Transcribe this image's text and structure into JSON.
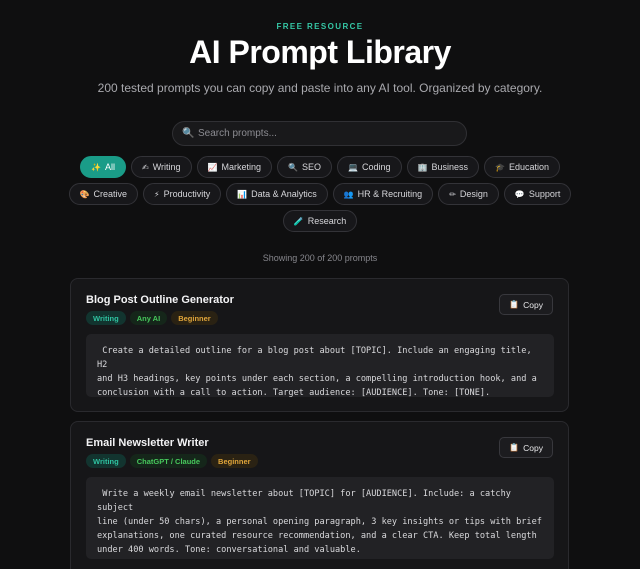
{
  "hero": {
    "eyebrow": "FREE RESOURCE",
    "title": "AI Prompt Library",
    "subtitle": "200 tested prompts you can copy and paste into any AI tool. Organized by category."
  },
  "search": {
    "icon": "search-icon",
    "placeholder": "Search prompts..."
  },
  "categories": [
    {
      "label": "All",
      "icon": "✨",
      "active": true
    },
    {
      "label": "Writing",
      "icon": "✍"
    },
    {
      "label": "Marketing",
      "icon": "📈"
    },
    {
      "label": "SEO",
      "icon": "🔍"
    },
    {
      "label": "Coding",
      "icon": "💻"
    },
    {
      "label": "Business",
      "icon": "🏢"
    },
    {
      "label": "Education",
      "icon": "🎓"
    },
    {
      "label": "Creative",
      "icon": "🎨"
    },
    {
      "label": "Productivity",
      "icon": "⚡"
    },
    {
      "label": "Data & Analytics",
      "icon": "📊"
    },
    {
      "label": "HR & Recruiting",
      "icon": "👥"
    },
    {
      "label": "Design",
      "icon": "✏"
    },
    {
      "label": "Support",
      "icon": "💬"
    },
    {
      "label": "Research",
      "icon": "🧪"
    }
  ],
  "count_text": "Showing 200 of 200 prompts",
  "copy_label": "Copy",
  "copy_icon": "📋",
  "prompts": [
    {
      "title": "Blog Post Outline Generator",
      "category": "Writing",
      "model": "Any AI",
      "level": "Beginner",
      "text": " Create a detailed outline for a blog post about [TOPIC]. Include an engaging title, H2\nand H3 headings, key points under each section, a compelling introduction hook, and a\nconclusion with a call to action. Target audience: [AUDIENCE]. Tone: [TONE]."
    },
    {
      "title": "Email Newsletter Writer",
      "category": "Writing",
      "model": "ChatGPT / Claude",
      "level": "Beginner",
      "text": " Write a weekly email newsletter about [TOPIC] for [AUDIENCE]. Include: a catchy subject\nline (under 50 chars), a personal opening paragraph, 3 key insights or tips with brief\nexplanations, one curated resource recommendation, and a clear CTA. Keep total length\nunder 400 words. Tone: conversational and valuable."
    }
  ],
  "colors": {
    "background": "#0f0f10",
    "accent": "#1a9c88",
    "eyebrow": "#35c7a5",
    "tag_model": "#47c85c",
    "tag_level": "#e0a53a"
  }
}
